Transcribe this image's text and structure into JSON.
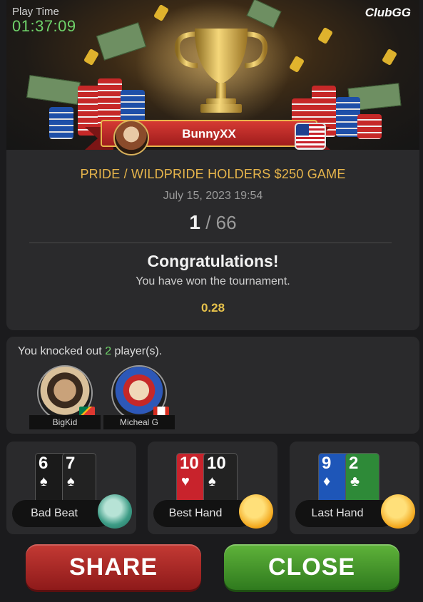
{
  "header": {
    "play_time_label": "Play Time",
    "play_time_value": "01:37:09",
    "brand": "ClubGG"
  },
  "winner": {
    "name": "BunnyXX",
    "flag": "us-flag-icon"
  },
  "tournament": {
    "title": "PRIDE / WILDPRIDE HOLDERS $250 GAME",
    "date": "July 15, 2023 19:54",
    "position": "1",
    "separator": "/",
    "total_players": "66",
    "congrats": "Congratulations!",
    "result_text": "You have won the tournament.",
    "prize": "0.28"
  },
  "knockouts": {
    "prefix": "You knocked out",
    "count": "2",
    "suffix": "player(s).",
    "players": [
      {
        "name": "BigKid",
        "flag": "south-africa-flag-icon"
      },
      {
        "name": "Micheal G",
        "flag": "canada-flag-icon"
      }
    ]
  },
  "hands": [
    {
      "label": "Bad Beat",
      "cards": [
        {
          "rank": "6",
          "suit": "♠",
          "color": "black"
        },
        {
          "rank": "7",
          "suit": "♠",
          "color": "black"
        }
      ],
      "emoji": "crying-emoji-icon"
    },
    {
      "label": "Best Hand",
      "cards": [
        {
          "rank": "10",
          "suit": "♥",
          "color": "red"
        },
        {
          "rank": "10",
          "suit": "♠",
          "color": "black"
        }
      ],
      "emoji": "thinking-emoji-icon"
    },
    {
      "label": "Last Hand",
      "cards": [
        {
          "rank": "9",
          "suit": "♦",
          "color": "blue"
        },
        {
          "rank": "2",
          "suit": "♣",
          "color": "green"
        }
      ],
      "emoji": "facepalm-emoji-icon"
    }
  ],
  "actions": {
    "share": "SHARE",
    "close": "CLOSE"
  },
  "colors": {
    "accent_gold": "#e7b54b",
    "time_green": "#6fd36a",
    "share_red": "#b02b27",
    "close_green": "#4a9a2c"
  }
}
